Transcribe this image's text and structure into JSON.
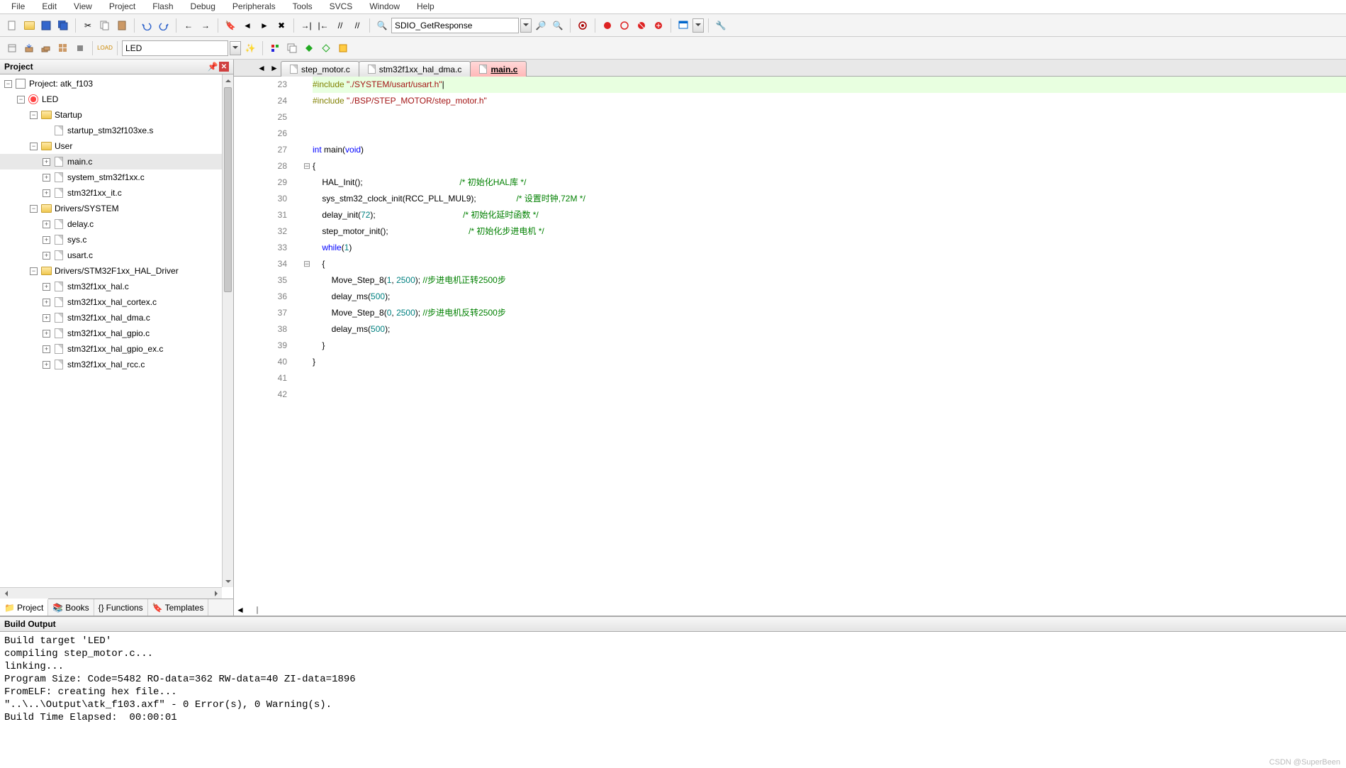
{
  "menu": [
    "File",
    "Edit",
    "View",
    "Project",
    "Flash",
    "Debug",
    "Peripherals",
    "Tools",
    "SVCS",
    "Window",
    "Help"
  ],
  "toolbar2_combo": "SDIO_GetResponse",
  "toolbar3_combo": "LED",
  "project": {
    "panel_title": "Project",
    "root": "Project: atk_f103",
    "target": "LED",
    "groups": [
      {
        "name": "Startup",
        "open": true,
        "files": [
          "startup_stm32f103xe.s"
        ]
      },
      {
        "name": "User",
        "open": true,
        "files": [
          "main.c",
          "system_stm32f1xx.c",
          "stm32f1xx_it.c"
        ],
        "selected": "main.c"
      },
      {
        "name": "Drivers/SYSTEM",
        "open": true,
        "files": [
          "delay.c",
          "sys.c",
          "usart.c"
        ]
      },
      {
        "name": "Drivers/STM32F1xx_HAL_Driver",
        "open": true,
        "files": [
          "stm32f1xx_hal.c",
          "stm32f1xx_hal_cortex.c",
          "stm32f1xx_hal_dma.c",
          "stm32f1xx_hal_gpio.c",
          "stm32f1xx_hal_gpio_ex.c",
          "stm32f1xx_hal_rcc.c"
        ]
      }
    ],
    "bottom_tabs": [
      "Project",
      "Books",
      "Functions",
      "Templates"
    ],
    "active_bottom_tab": 0
  },
  "editor_tabs": [
    {
      "name": "step_motor.c",
      "active": false
    },
    {
      "name": "stm32f1xx_hal_dma.c",
      "active": false
    },
    {
      "name": "main.c",
      "active": true
    }
  ],
  "code_lines": [
    {
      "n": 23,
      "hl": true,
      "tokens": [
        [
          "pp",
          "#include"
        ],
        [
          "",
          " "
        ],
        [
          "str",
          "\"./SYSTEM/usart/usart.h\""
        ],
        [
          "",
          "|"
        ]
      ]
    },
    {
      "n": 24,
      "tokens": [
        [
          "pp",
          "#include"
        ],
        [
          "",
          " "
        ],
        [
          "str",
          "\"./BSP/STEP_MOTOR/step_motor.h\""
        ]
      ]
    },
    {
      "n": 25,
      "tokens": []
    },
    {
      "n": 26,
      "tokens": []
    },
    {
      "n": 27,
      "tokens": [
        [
          "kw",
          "int"
        ],
        [
          "",
          " main("
        ],
        [
          "kw",
          "void"
        ],
        [
          "",
          ")"
        ]
      ]
    },
    {
      "n": 28,
      "fold": "⊟",
      "tokens": [
        [
          "",
          "{"
        ]
      ]
    },
    {
      "n": 29,
      "tokens": [
        [
          "",
          "    HAL_Init();                                         "
        ],
        [
          "cmt",
          "/* 初始化HAL库 */"
        ]
      ]
    },
    {
      "n": 30,
      "tokens": [
        [
          "",
          "    sys_stm32_clock_init(RCC_PLL_MUL9);                 "
        ],
        [
          "cmt",
          "/* 设置时钟,72M */"
        ]
      ]
    },
    {
      "n": 31,
      "tokens": [
        [
          "",
          "    delay_init("
        ],
        [
          "num",
          "72"
        ],
        [
          "",
          ");                                     "
        ],
        [
          "cmt",
          "/* 初始化延时函数 */"
        ]
      ]
    },
    {
      "n": 32,
      "tokens": [
        [
          "",
          "    step_motor_init();                                  "
        ],
        [
          "cmt",
          "/* 初始化步进电机 */"
        ]
      ]
    },
    {
      "n": 33,
      "tokens": [
        [
          "",
          "    "
        ],
        [
          "kw",
          "while"
        ],
        [
          "",
          "("
        ],
        [
          "num",
          "1"
        ],
        [
          "",
          ")"
        ]
      ]
    },
    {
      "n": 34,
      "fold": "⊟",
      "tokens": [
        [
          "",
          "    {"
        ]
      ]
    },
    {
      "n": 35,
      "tokens": [
        [
          "",
          "        Move_Step_8("
        ],
        [
          "num",
          "1"
        ],
        [
          "",
          ", "
        ],
        [
          "num",
          "2500"
        ],
        [
          "",
          "); "
        ],
        [
          "cmt",
          "//步进电机正转2500步"
        ]
      ]
    },
    {
      "n": 36,
      "tokens": [
        [
          "",
          "        delay_ms("
        ],
        [
          "num",
          "500"
        ],
        [
          "",
          ");"
        ]
      ]
    },
    {
      "n": 37,
      "tokens": [
        [
          "",
          "        Move_Step_8("
        ],
        [
          "num",
          "0"
        ],
        [
          "",
          ", "
        ],
        [
          "num",
          "2500"
        ],
        [
          "",
          "); "
        ],
        [
          "cmt",
          "//步进电机反转2500步"
        ]
      ]
    },
    {
      "n": 38,
      "tokens": [
        [
          "",
          "        delay_ms("
        ],
        [
          "num",
          "500"
        ],
        [
          "",
          ");"
        ]
      ]
    },
    {
      "n": 39,
      "tokens": [
        [
          "",
          "    }"
        ]
      ]
    },
    {
      "n": 40,
      "tokens": [
        [
          "",
          "}"
        ]
      ]
    },
    {
      "n": 41,
      "tokens": []
    },
    {
      "n": 42,
      "tokens": []
    }
  ],
  "build": {
    "title": "Build Output",
    "lines": [
      "Build target 'LED'",
      "compiling step_motor.c...",
      "linking...",
      "Program Size: Code=5482 RO-data=362 RW-data=40 ZI-data=1896",
      "FromELF: creating hex file...",
      "\"..\\..\\Output\\atk_f103.axf\" - 0 Error(s), 0 Warning(s).",
      "Build Time Elapsed:  00:00:01"
    ]
  },
  "watermark": "CSDN @SuperBeen"
}
